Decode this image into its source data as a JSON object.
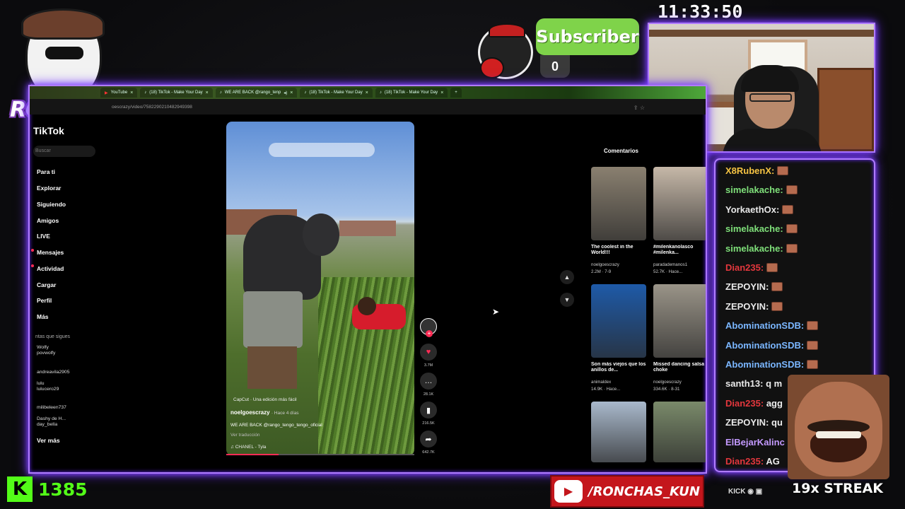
{
  "clock": "11:33:50",
  "subscriber": {
    "label": "Subscriber",
    "count": "0"
  },
  "logo_text": "RONCHAS",
  "browser": {
    "tabs": [
      {
        "label": "YouTube"
      },
      {
        "label": "(18) TikTok - Make Your Day"
      },
      {
        "label": "WE ARE BACK @rango_tenp"
      },
      {
        "label": "(18) TikTok - Make Your Day"
      },
      {
        "label": "(18) TikTok - Make Your Day"
      }
    ],
    "address": "oescrazy/video/7582290210482949398"
  },
  "tiktok": {
    "title": "TikTok",
    "search_placeholder": "Buscar",
    "nav": [
      "Para ti",
      "Explorar",
      "Siguiendo",
      "Amigos",
      "LIVE",
      "Mensajes",
      "Actividad",
      "Cargar",
      "Perfil",
      "Más"
    ],
    "following_header": "ntas que sigues",
    "accounts": [
      {
        "line1": "Wolfy",
        "line2": "povwolfy"
      },
      {
        "line1": "andreavila2905",
        "line2": ""
      },
      {
        "line1": "lulu",
        "line2": "lulucero29"
      },
      {
        "line1": "milibeleen737",
        "line2": ""
      },
      {
        "line1": "Dashy de H...",
        "line2": "day_bella"
      }
    ],
    "see_more": "Ver más",
    "video": {
      "capcut": "CapCut · Una edición más fácil",
      "user": "noelgoescrazy",
      "ago": "· Hace 4 días",
      "caption": "WE ARE BACK @rango_tengo_tengo_oficial",
      "translate": "Ver traducción",
      "music": "CHANEL - Tyla",
      "progress": 0.28
    },
    "actions": {
      "likes": "3.7M",
      "comments": "28.1K",
      "saves": "216.5K",
      "shares": "642.7K"
    },
    "comments_tab": "Comentarios",
    "related": [
      {
        "caption": "The coolest in the World!!!",
        "user": "noelgoescrazy",
        "meta": "2.2M · 7-9",
        "color": "#8a8070"
      },
      {
        "caption": "#milenkanolasco #milenka...",
        "user": "paradademanos1",
        "meta": "52.7K · Hace...",
        "color": "#c6b8a8"
      },
      {
        "caption": "Son más viejos que los anillos de...",
        "user": "animaldex",
        "meta": "14.9K · Hace...",
        "color": "#1e5aa8"
      },
      {
        "caption": "Missed dancing salsa choke",
        "user": "noelgoescrazy",
        "meta": "334.6K · 8-31",
        "color": "#9a9488"
      },
      {
        "caption": "",
        "user": "",
        "meta": "",
        "color": "#a9b9cc"
      },
      {
        "caption": "",
        "user": "",
        "meta": "",
        "color": "#7a8a6a"
      }
    ]
  },
  "chat": [
    {
      "user": "X8RubenX:",
      "msg": "",
      "color": "#f6c343"
    },
    {
      "user": "simelakache:",
      "msg": "",
      "color": "#7fe07a"
    },
    {
      "user": "YorkaethOx:",
      "msg": "",
      "color": "#e9e9e9"
    },
    {
      "user": "simelakache:",
      "msg": "",
      "color": "#7fe07a"
    },
    {
      "user": "simelakache:",
      "msg": "",
      "color": "#7fe07a"
    },
    {
      "user": "Dian235:",
      "msg": "",
      "color": "#e3373d"
    },
    {
      "user": "ZEPOYIN:",
      "msg": "",
      "color": "#e9e9e9"
    },
    {
      "user": "ZEPOYIN:",
      "msg": "",
      "color": "#e9e9e9"
    },
    {
      "user": "AbominationSDB:",
      "msg": "",
      "color": "#7ab6ff"
    },
    {
      "user": "AbominationSDB:",
      "msg": "",
      "color": "#7ab6ff"
    },
    {
      "user": "AbominationSDB:",
      "msg": "",
      "color": "#7ab6ff"
    },
    {
      "user": "santh13:",
      "msg": " q m",
      "color": "#e9e9e9"
    },
    {
      "user": "Dian235:",
      "msg": " agg",
      "color": "#e3373d"
    },
    {
      "user": "ZEPOYIN:",
      "msg": " qu",
      "color": "#e9e9e9"
    },
    {
      "user": "ElBejarKalinc",
      "msg": "",
      "color": "#c49aff"
    },
    {
      "user": "Dian235:",
      "msg": " AG",
      "color": "#e3373d"
    }
  ],
  "kick_count": "1385",
  "youtube_handle": "/RONCHAS_KUN",
  "social_text": "KICK",
  "streak": "19x STREAK",
  "colors": {
    "neon": "#b07cff",
    "kick": "#53fc18",
    "tiktok_red": "#fe2c55",
    "youtube": "#c4161c"
  }
}
